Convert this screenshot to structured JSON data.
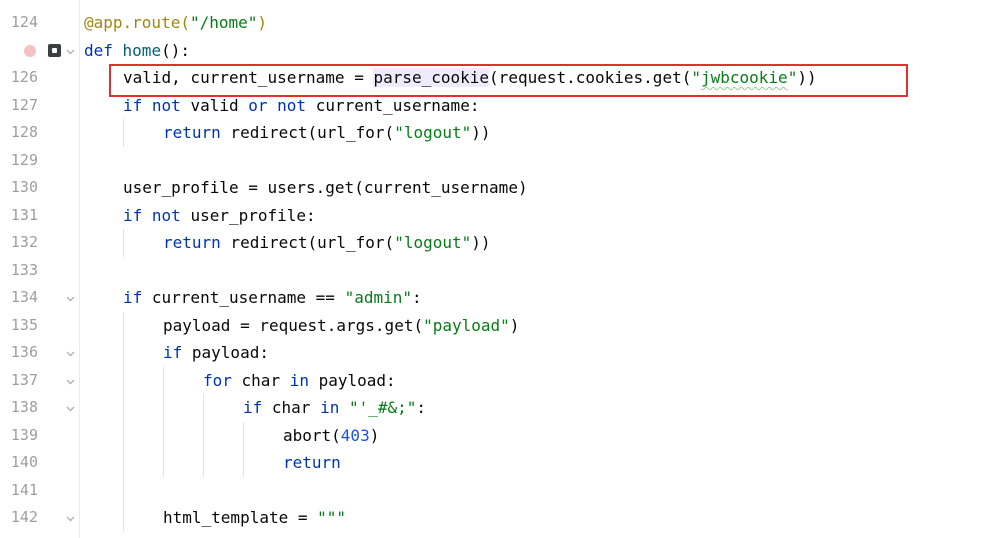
{
  "lines": {
    "124": {
      "num": "124",
      "t1": "@app.route(",
      "t2": "\"/home\"",
      "t3": ")"
    },
    "125": {
      "num": "",
      "t1": "def",
      "t2": " home",
      "t3": "():"
    },
    "126": {
      "num": "126",
      "t1": "valid, current_username = ",
      "t2": "parse_cookie",
      "t3": "(request.cookies.get(",
      "t4": "\"",
      "t5": "jwbcookie",
      "t6": "\"",
      "t7": "))"
    },
    "127": {
      "num": "127",
      "t1": "if",
      "t2": " ",
      "t3": "not",
      "t4": " valid ",
      "t5": "or",
      "t6": " ",
      "t7": "not",
      "t8": " current_username:"
    },
    "128": {
      "num": "128",
      "t1": "return",
      "t2": " redirect(url_for(",
      "t3": "\"logout\"",
      "t4": "))"
    },
    "129": {
      "num": "129"
    },
    "130": {
      "num": "130",
      "t1": "user_profile = users.get(current_username)"
    },
    "131": {
      "num": "131",
      "t1": "if",
      "t2": " ",
      "t3": "not",
      "t4": " user_profile:"
    },
    "132": {
      "num": "132",
      "t1": "return",
      "t2": " redirect(url_for(",
      "t3": "\"logout\"",
      "t4": "))"
    },
    "133": {
      "num": "133"
    },
    "134": {
      "num": "134",
      "t1": "if",
      "t2": " current_username == ",
      "t3": "\"admin\"",
      "t4": ":"
    },
    "135": {
      "num": "135",
      "t1": "payload = request.args.get(",
      "t2": "\"payload\"",
      "t3": ")"
    },
    "136": {
      "num": "136",
      "t1": "if",
      "t2": " payload:"
    },
    "137": {
      "num": "137",
      "t1": "for",
      "t2": " char ",
      "t3": "in",
      "t4": " payload:"
    },
    "138": {
      "num": "138",
      "t1": "if",
      "t2": " char ",
      "t3": "in",
      "t4": " ",
      "t5": "\"'_#&;\"",
      "t6": ":"
    },
    "139": {
      "num": "139",
      "t1": "abort(",
      "t2": "403",
      "t3": ")"
    },
    "140": {
      "num": "140",
      "t1": "return"
    },
    "141": {
      "num": "141"
    },
    "142": {
      "num": "142",
      "t1": "html_template = ",
      "t2": "\"\"\""
    }
  },
  "colors": {
    "keyword": "#0033b3",
    "string": "#067d17",
    "number": "#1750eb",
    "decorator": "#9e880d",
    "function_name": "#00627a",
    "highlight_box": "#e03131"
  },
  "icons": {
    "breakpoint": "breakpoint-icon",
    "run": "run-gutter-icon",
    "fold": "fold-chevron-icon"
  }
}
